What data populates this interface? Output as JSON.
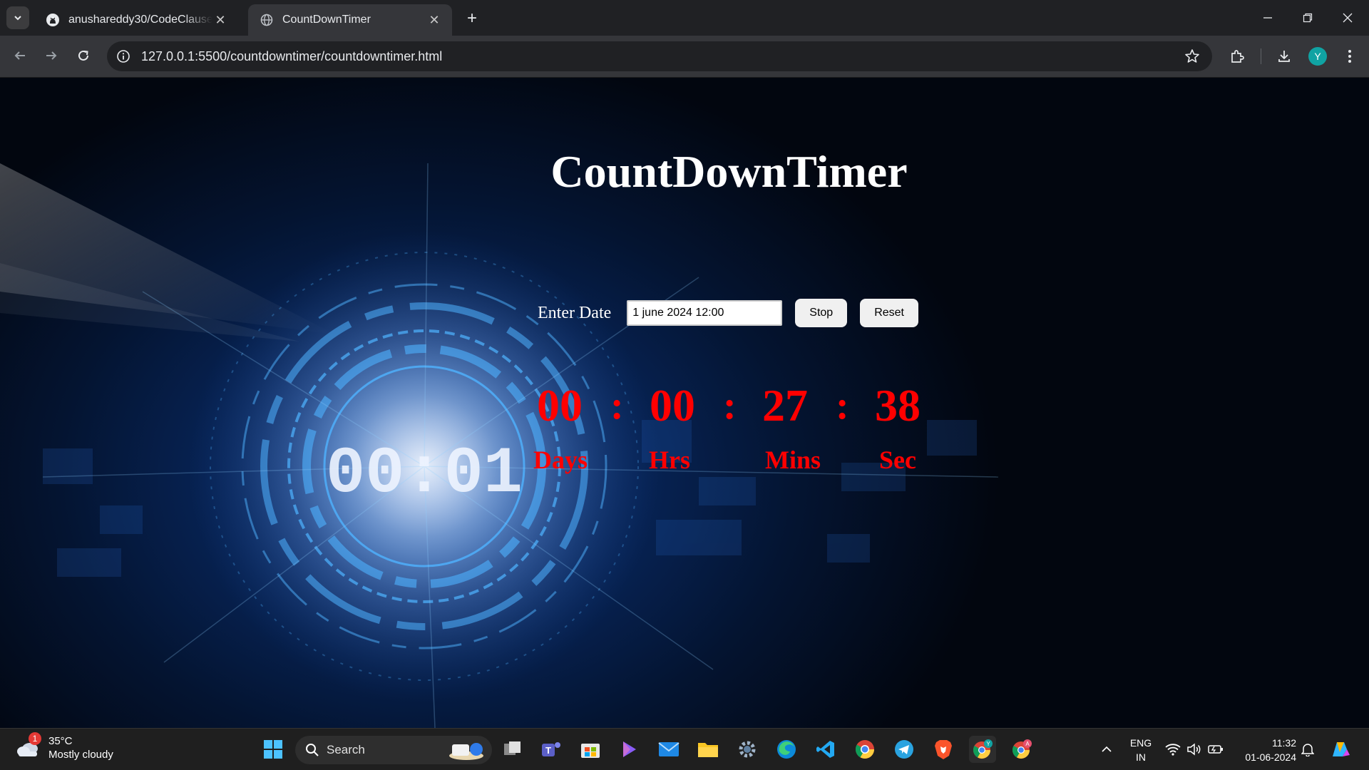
{
  "browser": {
    "tabs": [
      {
        "title": "anushareddy30/CodeClauseInternship",
        "active": false
      },
      {
        "title": "CountDownTimer",
        "active": true
      }
    ],
    "url": "127.0.0.1:5500/countdowntimer/countdowntimer.html",
    "profile_initial": "Y"
  },
  "page": {
    "title": "CountDownTimer",
    "date_label": "Enter Date",
    "date_value": "1 june 2024 12:00",
    "stop_label": "Stop",
    "reset_label": "Reset",
    "timer": {
      "days": "00",
      "hours": "00",
      "minutes": "27",
      "seconds": "38",
      "separator": ":",
      "days_label": "Days",
      "hours_label": "Hrs",
      "minutes_label": "Mins",
      "seconds_label": "Sec"
    },
    "background_clock_text": "00:01"
  },
  "taskbar": {
    "weather_badge": "1",
    "temperature": "35°C",
    "condition": "Mostly cloudy",
    "search_label": "Search",
    "language": "ENG",
    "region": "IN",
    "time": "11:32",
    "date": "01-06-2024"
  },
  "colors": {
    "timer": "#ff0000",
    "title": "#ffffff"
  }
}
